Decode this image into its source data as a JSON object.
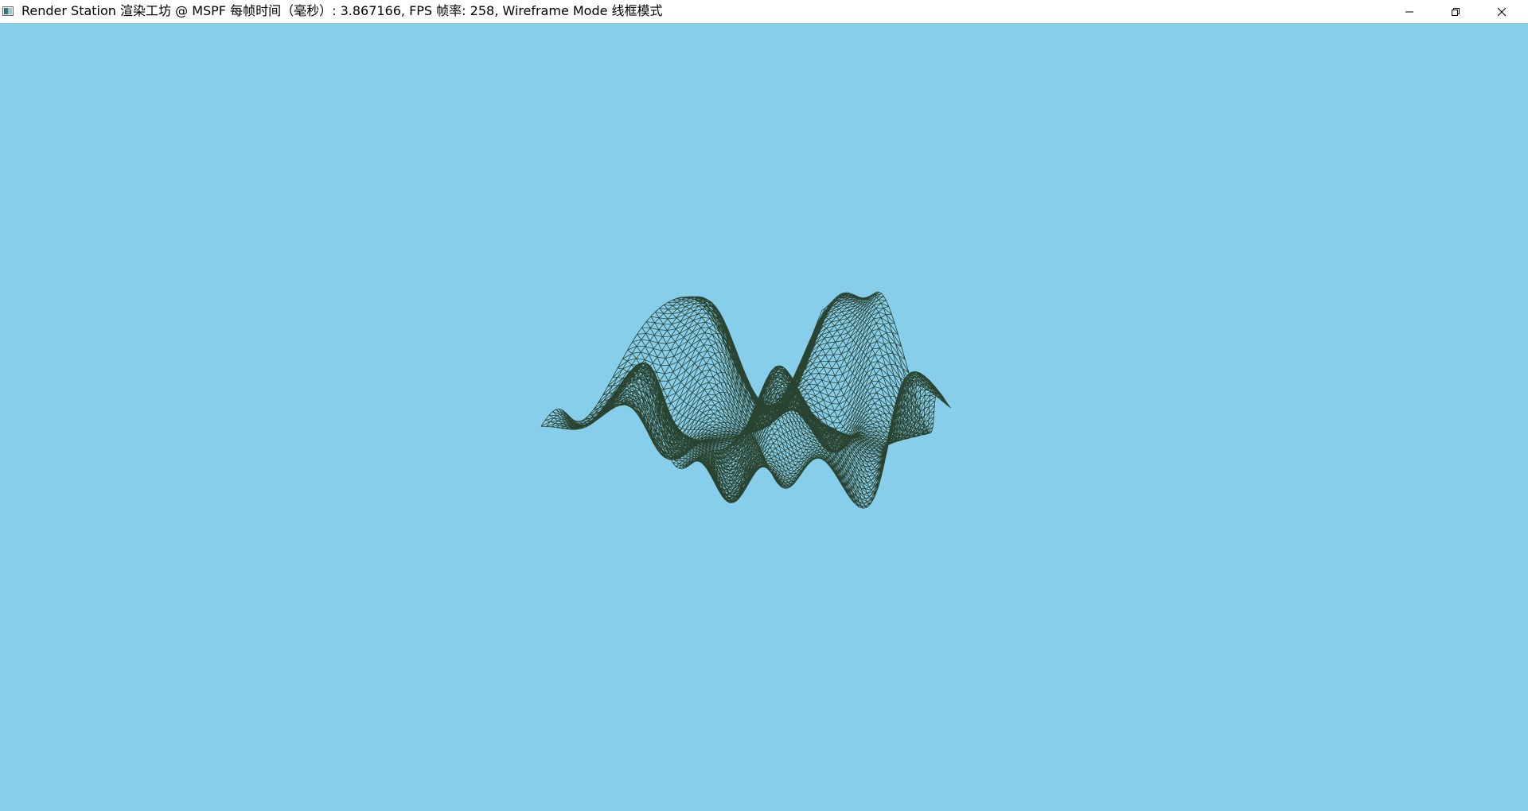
{
  "window": {
    "title": "Render Station 渲染工坊 @ MSPF 每帧时间（毫秒）: 3.867166, FPS 帧率: 258, Wireframe Mode 线框模式",
    "icon": "app-icon",
    "controls": {
      "minimize": "minimize-icon",
      "restore": "restore-icon",
      "close": "close-icon"
    }
  },
  "viewport": {
    "background": "#87CEEB",
    "mode": "wireframe",
    "mesh_color": "#1a2a10",
    "mesh": "wavy-terrain-grid"
  }
}
